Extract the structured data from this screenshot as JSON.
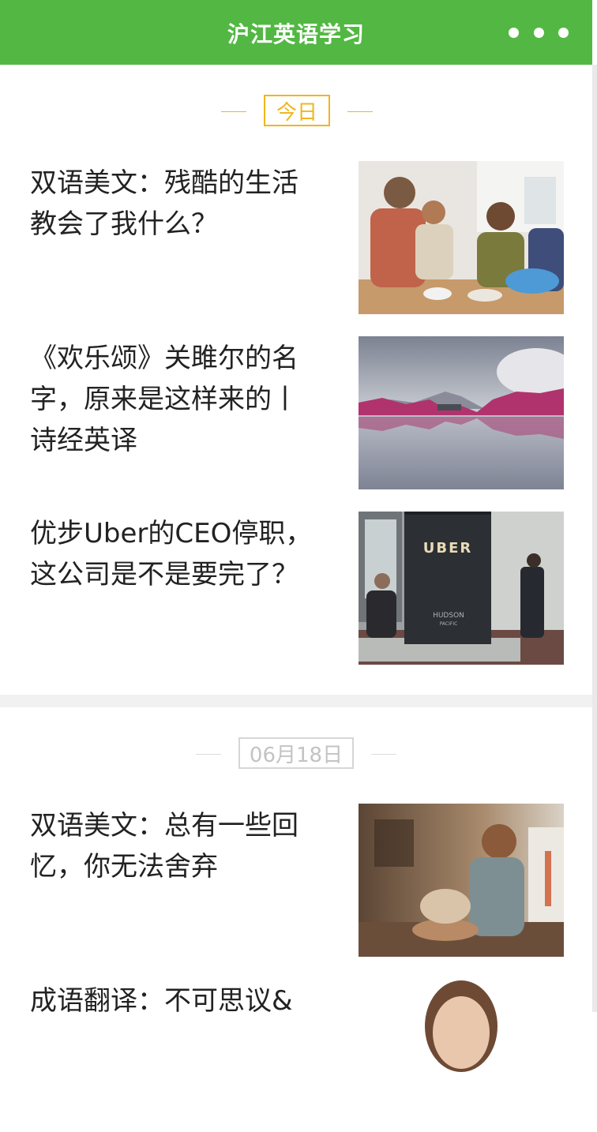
{
  "header": {
    "title": "沪江英语学习",
    "menu_icon": "more-dots-icon"
  },
  "colors": {
    "header_bg": "#52b843",
    "today_accent": "#f0b61e",
    "date_accent": "#c8c8c8"
  },
  "sections": [
    {
      "date_label": "今日",
      "articles": [
        {
          "title": "双语美文：残酷的生活教会了我什么？",
          "thumbnail": "family-baking-image"
        },
        {
          "title": "《欢乐颂》关雎尔的名字，原来是这样来的丨诗经英译",
          "thumbnail": "pink-lake-image"
        },
        {
          "title": "优步Uber的CEO停职，这公司是不是要完了？",
          "thumbnail": "uber-sign-image"
        }
      ]
    },
    {
      "date_label": "06月18日",
      "articles": [
        {
          "title": "双语美文：总有一些回忆，你无法舍弃",
          "thumbnail": "man-shoe-image"
        },
        {
          "title": "成语翻译：不可思议&",
          "thumbnail": "woman-portrait-image"
        }
      ]
    }
  ]
}
